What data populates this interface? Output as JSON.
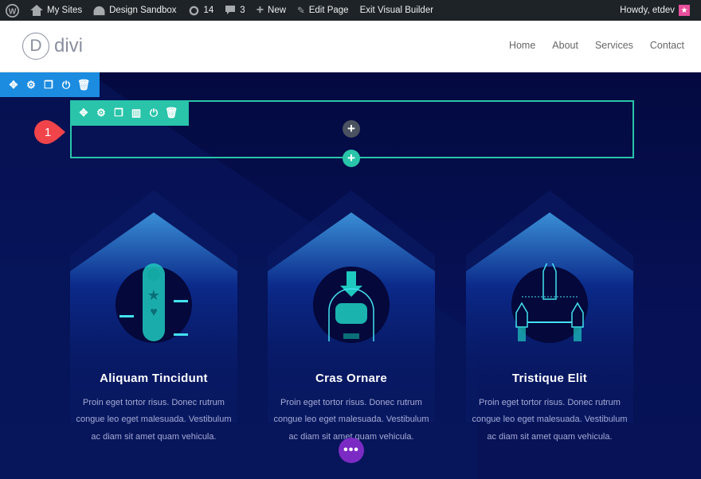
{
  "adminbar": {
    "my_sites": "My Sites",
    "site": "Design Sandbox",
    "updates": "14",
    "comments": "3",
    "new": "New",
    "edit": "Edit Page",
    "exit": "Exit Visual Builder",
    "howdy": "Howdy, etdev"
  },
  "header": {
    "logo_letter": "D",
    "logo_text": "divi",
    "nav": [
      "Home",
      "About",
      "Services",
      "Contact"
    ]
  },
  "builder": {
    "badge": "1",
    "colors": {
      "section": "#1b8ce0",
      "row": "#29c4a9",
      "more": "#7b2bc4"
    }
  },
  "cards": [
    {
      "title": "Aliquam Tincidunt",
      "text": "Proin eget tortor risus. Donec rutrum congue leo eget malesuada. Vestibulum ac diam sit amet quam vehicula.",
      "icon": "app-scroll-icon"
    },
    {
      "title": "Cras Ornare",
      "text": "Proin eget tortor risus. Donec rutrum congue leo eget malesuada. Vestibulum ac diam sit amet quam vehicula.",
      "icon": "astronaut-icon"
    },
    {
      "title": "Tristique Elit",
      "text": "Proin eget tortor risus. Donec rutrum congue leo eget malesuada. Vestibulum ac diam sit amet quam vehicula.",
      "icon": "rockets-icon"
    }
  ]
}
